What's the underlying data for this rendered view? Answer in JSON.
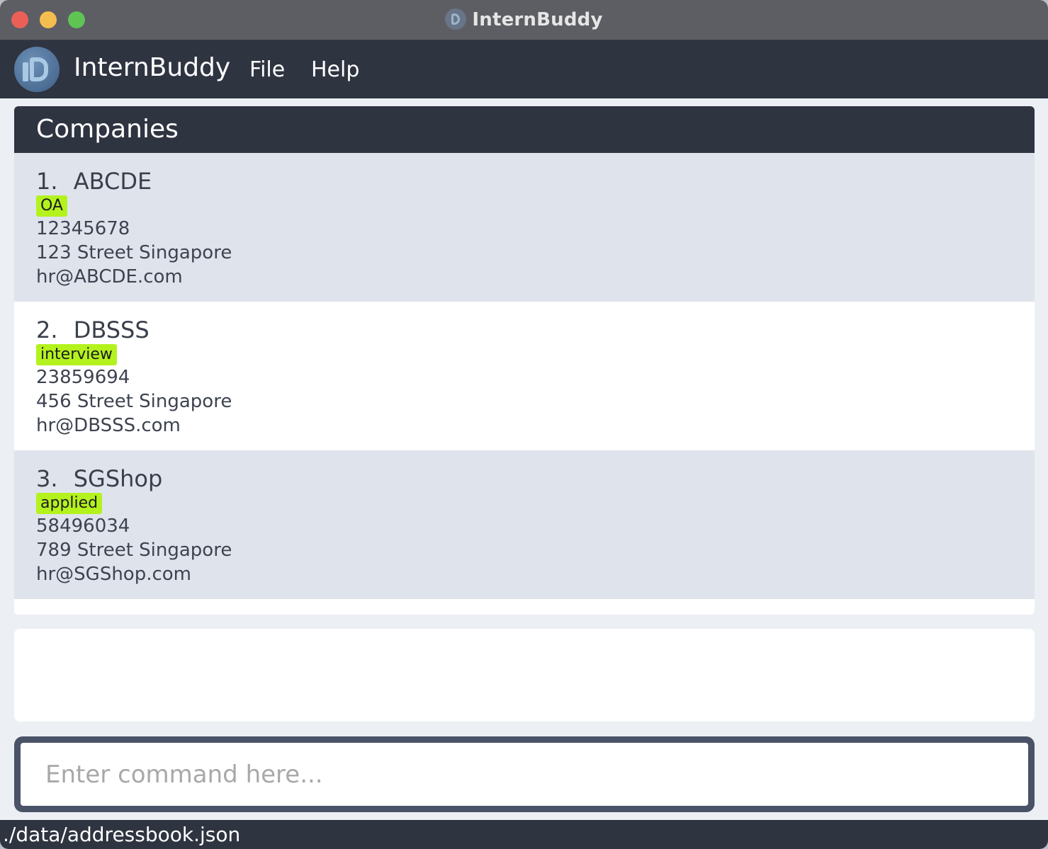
{
  "window": {
    "title": "InternBuddy"
  },
  "menubar": {
    "app_name": "InternBuddy",
    "file_label": "File",
    "help_label": "Help"
  },
  "companies": {
    "header": "Companies",
    "items": [
      {
        "index": "1.",
        "name": "ABCDE",
        "tag": "OA",
        "phone": "12345678",
        "address": "123 Street Singapore",
        "email": "hr@ABCDE.com"
      },
      {
        "index": "2.",
        "name": "DBSSS",
        "tag": "interview",
        "phone": "23859694",
        "address": "456 Street Singapore",
        "email": "hr@DBSSS.com"
      },
      {
        "index": "3.",
        "name": "SGShop",
        "tag": "applied",
        "phone": "58496034",
        "address": "789 Street Singapore",
        "email": "hr@SGShop.com"
      }
    ]
  },
  "result_display": {
    "text": ""
  },
  "command": {
    "placeholder": "Enter command here...",
    "value": ""
  },
  "statusbar": {
    "path": "./data/addressbook.json"
  },
  "colors": {
    "tag_bg": "#b4f21e",
    "dark_bar": "#2f3441",
    "card_alt_bg": "#dfe3ec"
  }
}
